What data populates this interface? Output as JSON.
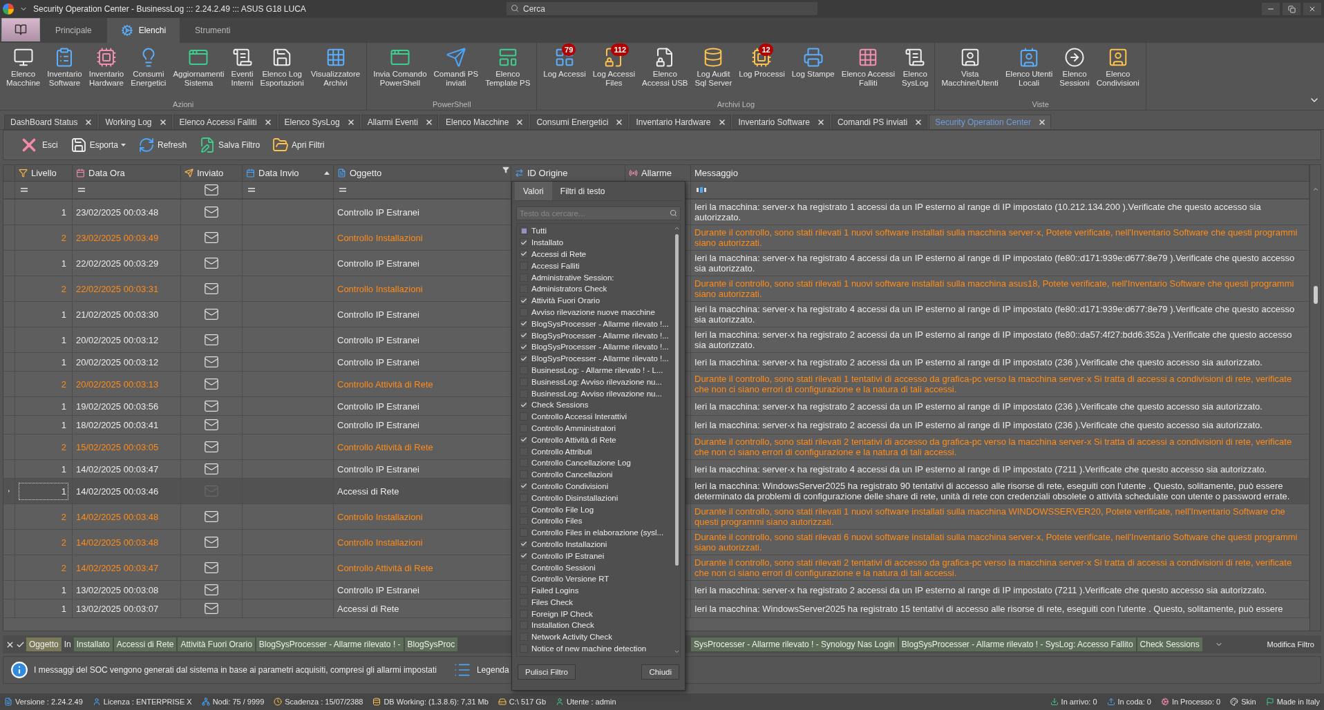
{
  "window": {
    "title": "Security Operation Center - BusinessLog ::: 2.24.2.49 ::: ASUS G18 LUCA",
    "search_placeholder": "Cerca"
  },
  "ribbon_tabs": [
    {
      "label": "Principale",
      "selected": false
    },
    {
      "label": "Elenchi",
      "selected": true
    },
    {
      "label": "Strumenti",
      "selected": false
    }
  ],
  "ribbon_groups": [
    {
      "title": "Azioni",
      "buttons": [
        {
          "label": "Elenco\nMacchine"
        },
        {
          "label": "Inventario\nSoftware"
        },
        {
          "label": "Inventario\nHardware"
        },
        {
          "label": "Consumi\nEnergetici"
        },
        {
          "label": "Aggiornamenti\nSistema"
        },
        {
          "label": "Eventi\nInterni"
        },
        {
          "label": "Elenco Log\nEsportazioni"
        },
        {
          "label": "Visualizzatore\nArchivi"
        }
      ]
    },
    {
      "title": "PowerShell",
      "buttons": [
        {
          "label": "Invia Comando\nPowerShell"
        },
        {
          "label": "Comandi PS\ninviati"
        },
        {
          "label": "Elenco\nTemplate PS"
        }
      ]
    },
    {
      "title": "Archivi Log",
      "buttons": [
        {
          "label": "Log Accessi",
          "badge": "79"
        },
        {
          "label": "Log Accessi\nFiles",
          "badge": "112"
        },
        {
          "label": "Elenco\nAccessi USB"
        },
        {
          "label": "Log Audit\nSql Server"
        },
        {
          "label": "Log Processi",
          "badge": "12"
        },
        {
          "label": "Log Stampe"
        },
        {
          "label": "Elenco Accessi\nFalliti"
        },
        {
          "label": "Elenco\nSysLog"
        }
      ]
    },
    {
      "title": "Viste",
      "buttons": [
        {
          "label": "Vista\nMacchine/Utenti"
        },
        {
          "label": "Elenco Utenti\nLocali"
        },
        {
          "label": "Elenco\nSessioni"
        },
        {
          "label": "Elenco\nCondivisioni"
        }
      ]
    }
  ],
  "document_tabs": [
    {
      "label": "DashBoard Status",
      "selected": false
    },
    {
      "label": "Working Log",
      "selected": false
    },
    {
      "label": "Elenco Accessi Falliti",
      "selected": false
    },
    {
      "label": "Elenco SysLog",
      "selected": false
    },
    {
      "label": "Allarmi Eventi",
      "selected": false
    },
    {
      "label": "Elenco Macchine",
      "selected": false
    },
    {
      "label": "Consumi Energetici",
      "selected": false
    },
    {
      "label": "Inventario Hardware",
      "selected": false
    },
    {
      "label": "Inventario Software",
      "selected": false
    },
    {
      "label": "Comandi PS inviati",
      "selected": false
    },
    {
      "label": "Security Operation Center",
      "selected": true
    }
  ],
  "toolbar": [
    {
      "label": "Esci",
      "dropdown": false
    },
    {
      "label": "Esporta",
      "dropdown": true
    },
    {
      "label": "Refresh",
      "dropdown": false
    },
    {
      "label": "Salva Filtro",
      "dropdown": false
    },
    {
      "label": "Apri Filtri",
      "dropdown": false
    }
  ],
  "grid": {
    "columns": [
      {
        "label": "Livello"
      },
      {
        "label": "Data Ora"
      },
      {
        "label": "Inviato"
      },
      {
        "label": "Data Invio",
        "sorted_ascending": true
      },
      {
        "label": "Oggetto",
        "filtered": true
      },
      {
        "label": "ID Origine"
      },
      {
        "label": "Allarme"
      },
      {
        "label": "Messaggio"
      }
    ],
    "rows": [
      {
        "level": "1",
        "date": "23/02/2025 00:03:48",
        "subject": "Controllo IP Estranei",
        "message": "Ieri la macchina: server-x ha registrato 1 accessi da un IP esterno al range di IP impostato (10.212.134.200 ).Verificate che questo accesso sia autorizzato.",
        "alert": false,
        "sent": true,
        "selected": false
      },
      {
        "level": "2",
        "date": "23/02/2025 00:03:49",
        "subject": "Controllo Installazioni",
        "message": "Durante il controllo, sono stati rilevati  1  nuovi software installati sulla macchina  server-x,  Potete verificate, nell'Inventario Software che questi programmi siano autorizzati.",
        "alert": true,
        "sent": true,
        "selected": false
      },
      {
        "level": "1",
        "date": "22/02/2025 00:03:29",
        "subject": "Controllo IP Estranei",
        "message": "Ieri la macchina: server-x ha registrato 4 accessi da un IP esterno al range di IP impostato (fe80::d171:939e:d677:8e79 ).Verificate che questo accesso sia autorizzato.",
        "alert": false,
        "sent": true,
        "selected": false
      },
      {
        "level": "2",
        "date": "22/02/2025 00:03:31",
        "subject": "Controllo Installazioni",
        "message": "Durante il controllo, sono stati rilevati  1  nuovi software installati sulla macchina  asus18,  Potete verificate, nell'Inventario Software che questi programmi siano autorizzati.",
        "alert": true,
        "sent": true,
        "selected": false
      },
      {
        "level": "1",
        "date": "21/02/2025 00:03:30",
        "subject": "Controllo IP Estranei",
        "message": "Ieri la macchina: server-x ha registrato 4 accessi da un IP esterno al range di IP impostato (fe80::d171:939e:d677:8e79 ).Verificate che questo accesso sia autorizzato.",
        "alert": false,
        "sent": true,
        "selected": false
      },
      {
        "level": "1",
        "date": "20/02/2025 00:03:12",
        "subject": "Controllo IP Estranei",
        "message": "Ieri la macchina: server-x ha registrato 2 accessi da un IP esterno al range di IP impostato (fe80::da57:4f27:bdd6:352a ).Verificate che questo accesso sia autorizzato.",
        "alert": false,
        "sent": true,
        "selected": false
      },
      {
        "level": "1",
        "date": "20/02/2025 00:03:12",
        "subject": "Controllo IP Estranei",
        "message": "Ieri la macchina: server-x ha registrato 2 accessi da un IP esterno al range di IP impostato (236 ).Verificate che questo accesso sia autorizzato.",
        "alert": false,
        "sent": true,
        "selected": false
      },
      {
        "level": "2",
        "date": "20/02/2025 00:03:13",
        "subject": "Controllo Attività di Rete",
        "message": "Durante il controllo, sono stati rilevati 1 tentativi di accesso da grafica-pc verso la macchina server-x Si tratta di accessi a condivisioni di rete, verificate che non ci siano errori di configurazione e la natura di tali accessi.",
        "alert": true,
        "sent": true,
        "selected": false
      },
      {
        "level": "1",
        "date": "19/02/2025 00:03:56",
        "subject": "Controllo IP Estranei",
        "message": "Ieri la macchina: server-x ha registrato 2 accessi da un IP esterno al range di IP impostato (236 ).Verificate che questo accesso sia autorizzato.",
        "alert": false,
        "sent": true,
        "selected": false
      },
      {
        "level": "1",
        "date": "18/02/2025 00:03:41",
        "subject": "Controllo IP Estranei",
        "message": "Ieri la macchina: server-x ha registrato 2 accessi da un IP esterno al range di IP impostato (236 ).Verificate che questo accesso sia autorizzato.",
        "alert": false,
        "sent": true,
        "selected": false
      },
      {
        "level": "2",
        "date": "15/02/2025 00:03:05",
        "subject": "Controllo Attività di Rete",
        "message": "Durante il controllo, sono stati rilevati 2 tentativi di accesso da grafica-pc verso la macchina server-x Si tratta di accessi a condivisioni di rete, verificate che non ci siano errori di configurazione e la natura di tali accessi.",
        "alert": true,
        "sent": true,
        "selected": false
      },
      {
        "level": "1",
        "date": "14/02/2025 00:03:47",
        "subject": "Controllo IP Estranei",
        "message": "Ieri la macchina: server-x ha registrato 4 accessi da un IP esterno al range di IP impostato (7211 ).Verificate che questo accesso sia autorizzato.",
        "alert": false,
        "sent": true,
        "selected": false
      },
      {
        "level": "1",
        "date": "14/02/2025 00:03:46",
        "subject": "Accessi di Rete",
        "message": "Ieri la macchina:  WindowsServer2025  ha registrato  90  tentativi di accesso alle risorse di rete, eseguiti con l'utente   . Questo, solitamente, può essere determinato da problemi di configurazione delle share di rete, unità di rete con credenziali obsolete o attività schedulate con utente o password errate.",
        "alert": false,
        "sent": false,
        "selected": true
      },
      {
        "level": "2",
        "date": "14/02/2025 00:03:48",
        "subject": "Controllo Installazioni",
        "message": "Durante il controllo, sono stati rilevati  1  nuovi software installati sulla macchina  WINDOWSSERVER20,  Potete verificate, nell'Inventario Software che questi programmi siano autorizzati.",
        "alert": true,
        "sent": true,
        "selected": false
      },
      {
        "level": "2",
        "date": "14/02/2025 00:03:48",
        "subject": "Controllo Installazioni",
        "message": "Durante il controllo, sono stati rilevati  6  nuovi software installati sulla macchina  server-x,  Potete verificate, nell'Inventario Software che questi programmi siano autorizzati.",
        "alert": true,
        "sent": true,
        "selected": false
      },
      {
        "level": "2",
        "date": "14/02/2025 00:03:47",
        "subject": "Controllo Attività di Rete",
        "message": "Durante il controllo, sono stati rilevati 2 tentativi di accesso da grafica-pc verso la macchina server-x Si tratta di accessi a condivisioni di rete, verificate che non ci siano errori di configurazione e la natura di tali accessi.",
        "alert": true,
        "sent": true,
        "selected": false
      },
      {
        "level": "1",
        "date": "13/02/2025 00:03:08",
        "subject": "Controllo IP Estranei",
        "message": "Ieri la macchina: server-x ha registrato 2 accessi da un IP esterno al range di IP impostato (7211 ).Verificate che questo accesso sia autorizzato.",
        "alert": false,
        "sent": true,
        "selected": false
      },
      {
        "level": "1",
        "date": "13/02/2025 00:03:07",
        "subject": "Accessi di Rete",
        "message": "Ieri la macchina:  WindowsServer2025  ha registrato  15  tentativi di accesso alle risorse di rete, eseguiti con l'utente   . Questo, solitamente, può essere",
        "alert": false,
        "sent": true,
        "selected": false
      }
    ]
  },
  "filter_popup": {
    "tabs": [
      {
        "label": "Valori",
        "selected": true
      },
      {
        "label": "Filtri di testo",
        "selected": false
      }
    ],
    "search_placeholder": "Testo da cercare...",
    "all_item": {
      "label": "Tutti",
      "partial": true
    },
    "items": [
      {
        "label": "Installato",
        "checked": true
      },
      {
        "label": "Accessi di Rete",
        "checked": true
      },
      {
        "label": "Accessi Falliti",
        "checked": false
      },
      {
        "label": "Administrative Session:",
        "checked": false
      },
      {
        "label": "Administrators Check",
        "checked": false
      },
      {
        "label": "Attività Fuori Orario",
        "checked": true
      },
      {
        "label": "Avviso rilevazione nuove macchine",
        "checked": false
      },
      {
        "label": "BlogSysProcesser - Allarme rilevato !...",
        "checked": true
      },
      {
        "label": "BlogSysProcesser - Allarme rilevato !...",
        "checked": true
      },
      {
        "label": "BlogSysProcesser - Allarme rilevato !...",
        "checked": true
      },
      {
        "label": "BlogSysProcesser - Allarme rilevato !...",
        "checked": true
      },
      {
        "label": "BusinessLog:  - Allarme rilevato ! - L...",
        "checked": false
      },
      {
        "label": "BusinessLog: Avviso rilevazione nu...",
        "checked": false
      },
      {
        "label": "BusinessLog: Avviso rilevazione nu...",
        "checked": false
      },
      {
        "label": "Check Sessions",
        "checked": true
      },
      {
        "label": "Controllo Accessi Interattivi",
        "checked": false
      },
      {
        "label": "Controllo Amministratori",
        "checked": false
      },
      {
        "label": "Controllo Attività di Rete",
        "checked": true
      },
      {
        "label": "Controllo Attributi",
        "checked": false
      },
      {
        "label": "Controllo Cancellazione Log",
        "checked": false
      },
      {
        "label": "Controllo Cancellazioni",
        "checked": false
      },
      {
        "label": "Controllo Condivisioni",
        "checked": true
      },
      {
        "label": "Controllo Disinstallazioni",
        "checked": false
      },
      {
        "label": "Controllo File Log",
        "checked": false
      },
      {
        "label": "Controllo Files",
        "checked": false
      },
      {
        "label": "Controllo Files in elaborazione (sysl...",
        "checked": false
      },
      {
        "label": "Controllo Installazioni",
        "checked": true
      },
      {
        "label": "Controllo IP Estranei",
        "checked": true
      },
      {
        "label": "Controllo Sessioni",
        "checked": false
      },
      {
        "label": "Controllo Versione RT",
        "checked": false
      },
      {
        "label": "Failed Logins",
        "checked": false
      },
      {
        "label": "Files Check",
        "checked": false
      },
      {
        "label": "Foreign IP Check",
        "checked": false
      },
      {
        "label": "Installation Check",
        "checked": false
      },
      {
        "label": "Network Activity Check",
        "checked": false
      },
      {
        "label": "Notice of new machine detection",
        "checked": false
      }
    ],
    "buttons": [
      "Pulisci Filtro",
      "Chiudi"
    ]
  },
  "filter_bar": {
    "field": "Oggetto",
    "operator": "In",
    "values_before": [
      "Installato",
      "Accessi di Rete",
      "Attività Fuori Orario",
      "BlogSysProcesser - Allarme rilevato ! -",
      "BlogSysProc"
    ],
    "values_after": [
      "SysProcesser - Allarme rilevato ! - Synology Nas Login",
      "BlogSysProcesser - Allarme rilevato ! - SysLog: Accesso Fallito",
      "Check Sessions"
    ],
    "edit_label": "Modifica Filtro"
  },
  "info_bar": {
    "message": "I messaggi del SOC vengono generati dal sistema in base ai parametri acquisiti, compresi gli allarmi impostati",
    "legend_button": "Legenda"
  },
  "status_bar": {
    "left": [
      "Versione : 2.24.2.49",
      "Licenza : ENTERPRISE X",
      "Nodi: 75 / 9999",
      "Scadenza : 15/07/2388",
      "DB Working: (1.3.8.6): 7,31 Mb",
      "C:\\ 517 Gb",
      "Utente : admin"
    ],
    "right": [
      "In arrivo: 0",
      "In coda: 0",
      "In Processo: 0",
      "Skin",
      "Made in Italy"
    ]
  }
}
